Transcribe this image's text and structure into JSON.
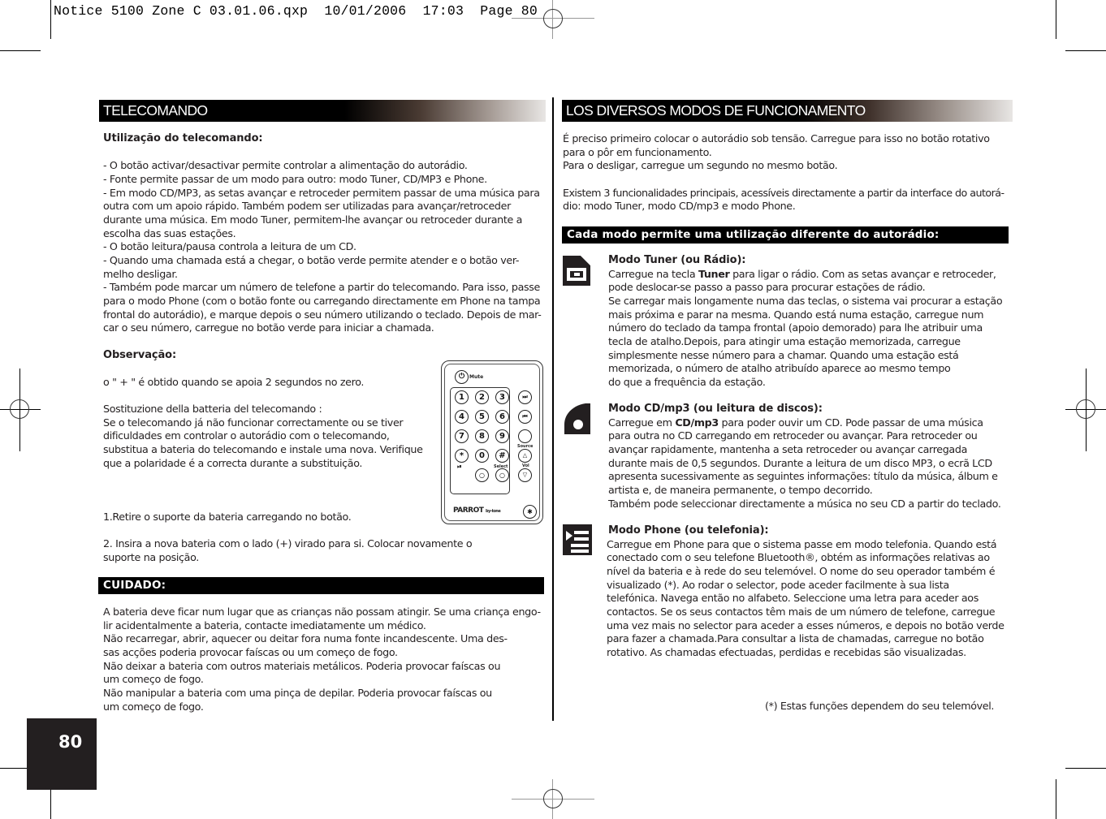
{
  "slug": "Notice 5100 Zone C 03.01.06.qxp  10/01/2006  17:03  Page 80",
  "page_number": "80",
  "left": {
    "title": "TELECOMANDO",
    "usage_heading": "Utilização do telecomando:",
    "usage_lines": [
      "- O botão activar/desactivar permite controlar a alimentação do autorádio.",
      "- Fonte permite passar de um modo para outro: modo Tuner, CD/MP3 e Phone.",
      "- Em modo CD/MP3, as setas avançar e retroceder permitem passar de uma música para",
      "outra com um apoio rápido. Também podem ser utilizadas para avançar/retroceder",
      "durante uma música. Em modo Tuner, permitem-lhe avançar ou retroceder durante a",
      "escolha das suas estações.",
      "- O botão leitura/pausa controla a leitura de um CD.",
      "- Quando uma chamada está a chegar, o botão verde permite atender e o botão ver-",
      "melho desligar.",
      "- Também pode marcar um número de telefone a partir do telecomando. Para isso, passe",
      "para o modo Phone (com o botão fonte ou carregando directamente em Phone na tampa",
      "frontal do autorádio), e marque depois o seu número utilizando o teclado. Depois de mar-",
      "car o seu número, carregue no botão verde para iniciar a chamada."
    ],
    "note_heading": "Observação:",
    "note_text": "o \" + \" é obtido quando se apoia 2 segundos no zero.",
    "battery_lines": [
      "Sostituzione della batteria del telecomando :",
      "Se o telecomando já não funcionar correctamente ou se tiver",
      "dificuldades em controlar o autorádio com o telecomando,",
      "substitua a bateria do telecomando e instale uma nova. Verifique",
      "que a polaridade é a correcta durante a substituição."
    ],
    "step1": "1.Retire o suporte da bateria carregando no botão.",
    "step2_lines": [
      "2. Insira a nova bateria com o lado (+) virado para si. Colocar novamente o",
      "suporte na posição."
    ],
    "caution_title": "CUIDADO:",
    "caution_lines": [
      "A bateria deve ficar num lugar que as crianças não possam atingir. Se uma criança engo-",
      "lir acidentalmente a bateria, contacte imediatamente um médico.",
      "Não recarregar, abrir, aquecer ou deitar fora numa fonte incandescente. Uma des-",
      "sas acções poderia provocar faíscas ou um começo de fogo.",
      "Não deixar a bateria com outros materiais metálicos. Poderia provocar faíscas ou",
      "um começo de fogo.",
      "Não manipular a bateria com uma pinça de depilar. Poderia provocar faíscas ou",
      "um começo de fogo."
    ],
    "remote": {
      "mute_label": "Mute",
      "keys": [
        "1",
        "2",
        "3",
        "4",
        "5",
        "6",
        "7",
        "8",
        "9",
        "*",
        "0",
        "#"
      ],
      "source_label": "Source",
      "select_label": "Select",
      "vol_label": "Vol",
      "brand": "PARROT",
      "brand_sub": "by-tone"
    }
  },
  "right": {
    "title": "LOS DIVERSOS MODOS DE FUNCIONAMENTO",
    "intro_lines": [
      "É preciso primeiro colocar o autorádio sob tensão. Carregue para isso no botão rotativo",
      "para o pôr em funcionamento.",
      "Para o desligar, carregue um segundo no mesmo botão."
    ],
    "intro2_lines": [
      "Existem 3 funcionalidades principais, acessíveis directamente a partir da interface do autorá-",
      "dio: modo Tuner, modo CD/mp3 e modo Phone."
    ],
    "modes_bar": "Cada modo permite uma utilização diferente do autorádio:",
    "modes": [
      {
        "icon": "tuner-icon",
        "heading": "Modo Tuner (ou Rádio):",
        "first_pre": "Carregue na tecla ",
        "first_bold": "Tuner",
        "first_post": " para ligar o rádio. Com as setas avançar e retroceder,",
        "lines": [
          "pode deslocar-se passo a passo para procurar estações de rádio.",
          "Se carregar mais longamente numa das teclas, o sistema vai procurar a estação",
          "mais próxima e parar na mesma. Quando está numa estação, carregue num",
          "número do teclado da tampa frontal (apoio demorado) para lhe atribuir uma",
          "tecla de atalho.Depois, para atingir uma estação memorizada, carregue",
          "simplesmente nesse número para a chamar. Quando uma estação está",
          "memorizada, o número de atalho atribuído aparece ao mesmo tempo",
          "do que a frequência da estação."
        ]
      },
      {
        "icon": "cd-icon",
        "heading": "Modo CD/mp3 (ou leitura de discos):",
        "first_pre": "Carregue em ",
        "first_bold": "CD/mp3",
        "first_post": " para poder ouvir um CD. Pode passar de uma música",
        "lines": [
          "para outra no CD carregando em retroceder ou avançar. Para retroceder ou",
          "avançar rapidamente, mantenha a seta retroceder ou avançar carregada",
          "durante mais de 0,5 segundos. Durante a leitura de um disco MP3, o ecrã LCD",
          "apresenta sucessivamente as seguintes informações: título da música, álbum e",
          "artista e, de maneira permanente, o tempo decorrido.",
          "Também pode seleccionar directamente a música no seu CD a partir do teclado."
        ]
      },
      {
        "icon": "phone-icon",
        "heading": "Modo Phone (ou telefonia):",
        "first_pre": "Carregue em Phone para que o sistema passe em modo telefonia. Quando está",
        "first_bold": "",
        "first_post": "",
        "lines": [
          "conectado com o seu telefone Bluetooth®, obtém as informações relativas ao",
          "nível da bateria e à rede do seu telemóvel. O nome do seu operador também é",
          "visualizado (*). Ao rodar o selector, pode aceder facilmente à sua lista",
          "telefónica. Navega então no alfabeto.  Seleccione uma letra para aceder aos",
          "contactos. Se os seus contactos têm mais de um número de telefone, carregue",
          "uma vez mais no selector para aceder a esses números, e depois no botão verde",
          "para fazer a chamada.Para consultar a lista de chamadas, carregue no botão",
          "rotativo. As chamadas efectuadas, perdidas e recebidas são visualizadas."
        ]
      }
    ],
    "footnote": "(*) Estas funções dependem do seu telemóvel."
  }
}
